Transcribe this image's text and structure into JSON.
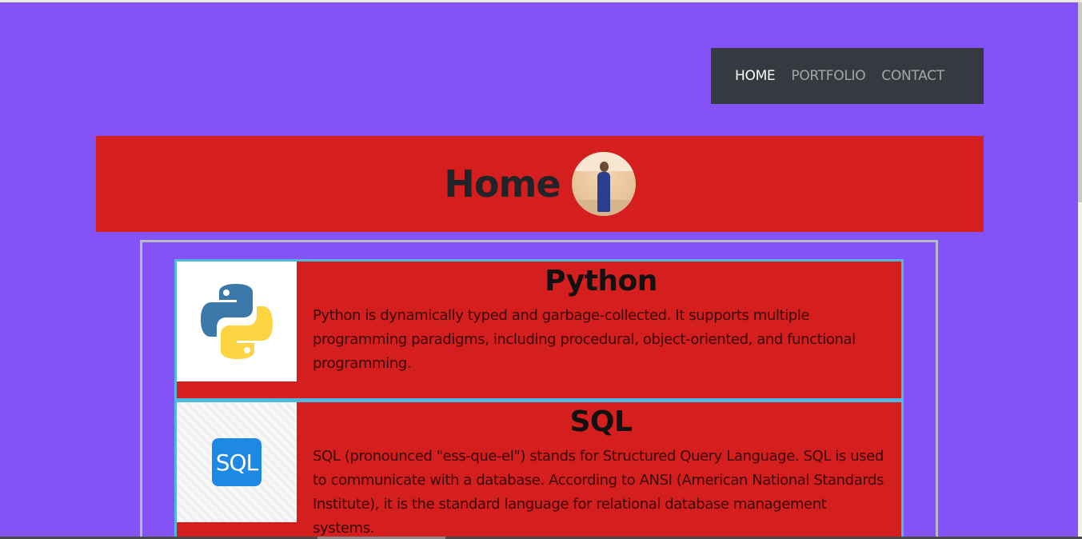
{
  "nav": {
    "items": [
      {
        "label": "HOME",
        "active": true
      },
      {
        "label": "PORTFOLIO",
        "active": false
      },
      {
        "label": "CONTACT",
        "active": false
      }
    ]
  },
  "header": {
    "title": "Home"
  },
  "cards": [
    {
      "title": "Python",
      "icon": "python-logo-icon",
      "text": "Python is dynamically typed and garbage-collected. It supports multiple programming paradigms, including procedural, object-oriented, and functional programming."
    },
    {
      "title": "SQL",
      "icon": "sql-logo-icon",
      "logo_text": "SQL",
      "text": "SQL (pronounced \"ess-que-el\") stands for Structured Query Language. SQL is used to communicate with a database. According to ANSI (American National Standards Institute), it is the standard language for relational database management systems."
    }
  ],
  "colors": {
    "page_background": "#8453f5",
    "navbar": "#343a40",
    "header": "#d51e1e",
    "card_background": "#d51e1e",
    "card_border": "#4fb8e0"
  }
}
